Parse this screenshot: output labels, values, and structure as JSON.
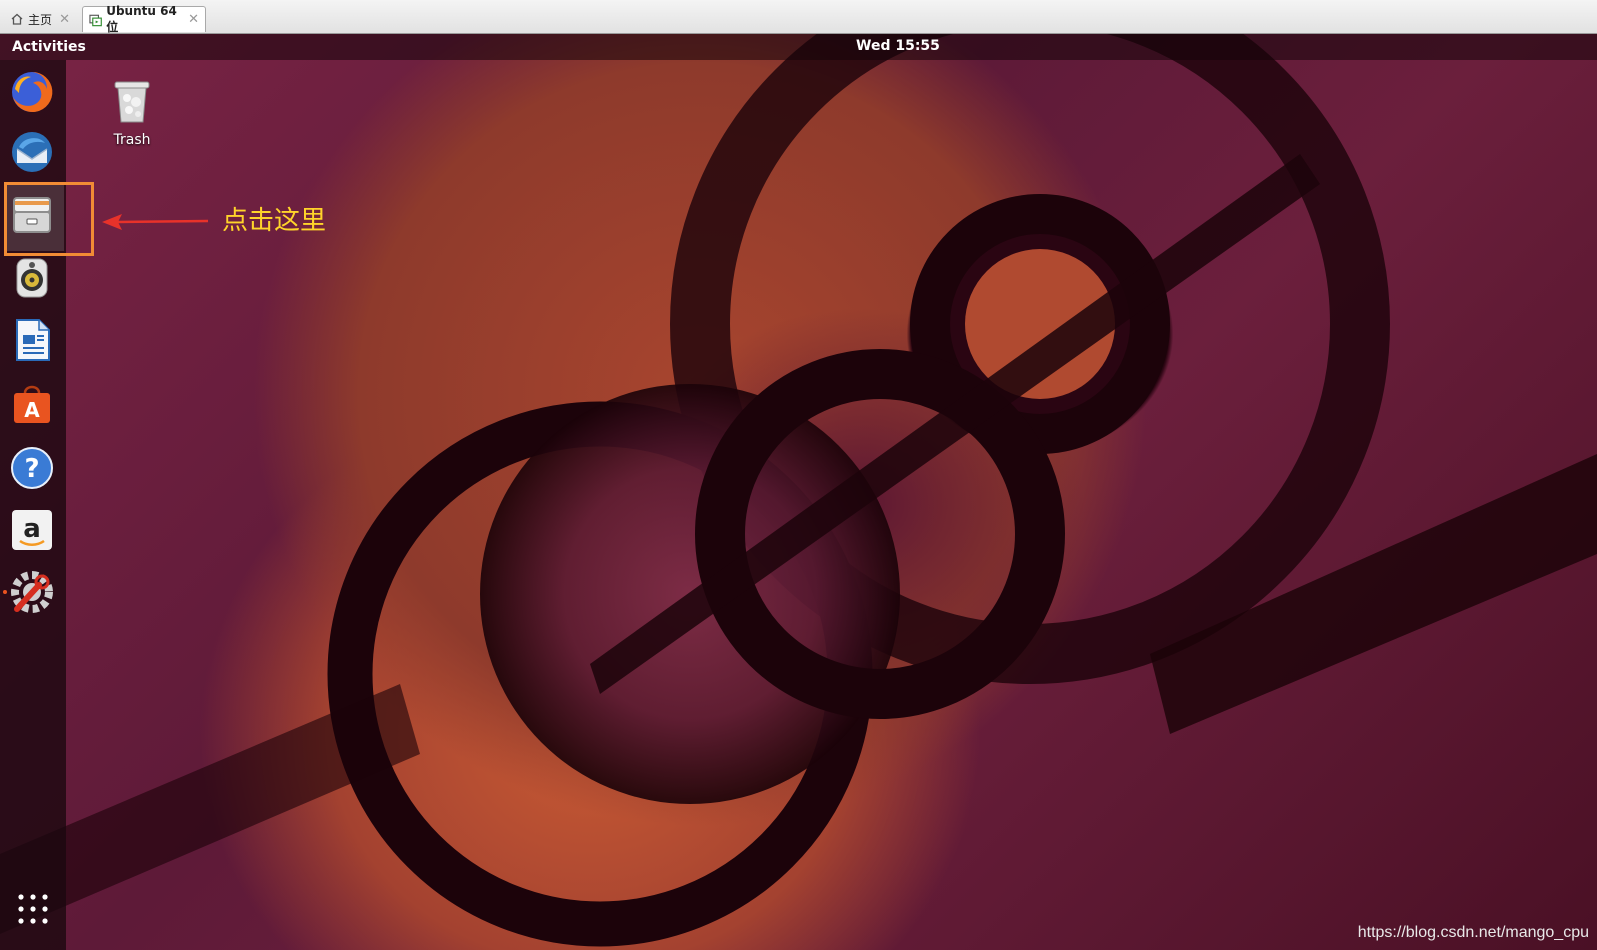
{
  "vm_tabs": {
    "home_label": "主页",
    "active_label": "Ubuntu 64 位",
    "close_glyph": "✕"
  },
  "topbar": {
    "activities": "Activities",
    "clock": "Wed 15:55"
  },
  "dock": {
    "items": [
      {
        "name": "firefox-icon"
      },
      {
        "name": "thunderbird-icon"
      },
      {
        "name": "files-icon"
      },
      {
        "name": "rhythmbox-icon"
      },
      {
        "name": "libreoffice-writer-icon"
      },
      {
        "name": "software-center-icon"
      },
      {
        "name": "help-icon"
      },
      {
        "name": "amazon-icon"
      },
      {
        "name": "software-updater-icon"
      }
    ],
    "app_grid": "show-applications-icon"
  },
  "desktop": {
    "trash_label": "Trash"
  },
  "annotation": {
    "text": "点击这里",
    "color": "#ffd42a"
  },
  "watermark": "https://blog.csdn.net/mango_cpu",
  "colors": {
    "ubuntu_orange": "#e95420",
    "highlight": "#f28c35",
    "arrow": "#e8322a"
  }
}
